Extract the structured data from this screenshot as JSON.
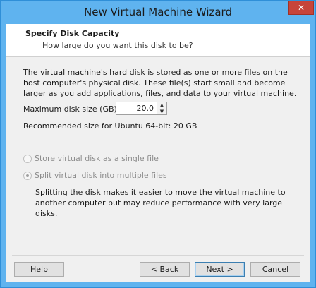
{
  "window": {
    "title": "New Virtual Machine Wizard",
    "close_glyph": "✕"
  },
  "header": {
    "title": "Specify Disk Capacity",
    "subtitle": "How large do you want this disk to be?"
  },
  "body": {
    "intro": "The virtual machine's hard disk is stored as one or more files on the host computer's physical disk. These file(s) start small and become larger as you add applications, files, and data to your virtual machine.",
    "max_size_label": "Maximum disk size (GB):",
    "max_size_value": "20.0",
    "recommended": "Recommended size for Ubuntu 64-bit: 20 GB",
    "radio_single": {
      "label": "Store virtual disk as a single file",
      "checked": false,
      "enabled": false
    },
    "radio_multiple": {
      "label": "Split virtual disk into multiple files",
      "checked": true,
      "enabled": false
    },
    "split_description": "Splitting the disk makes it easier to move the virtual machine to another computer but may reduce performance with very large disks."
  },
  "buttons": {
    "help": "Help",
    "back": "< Back",
    "next": "Next >",
    "cancel": "Cancel"
  },
  "colors": {
    "titlebar": "#5fb3ef",
    "close": "#c7443a",
    "client": "#f0f0f0"
  }
}
